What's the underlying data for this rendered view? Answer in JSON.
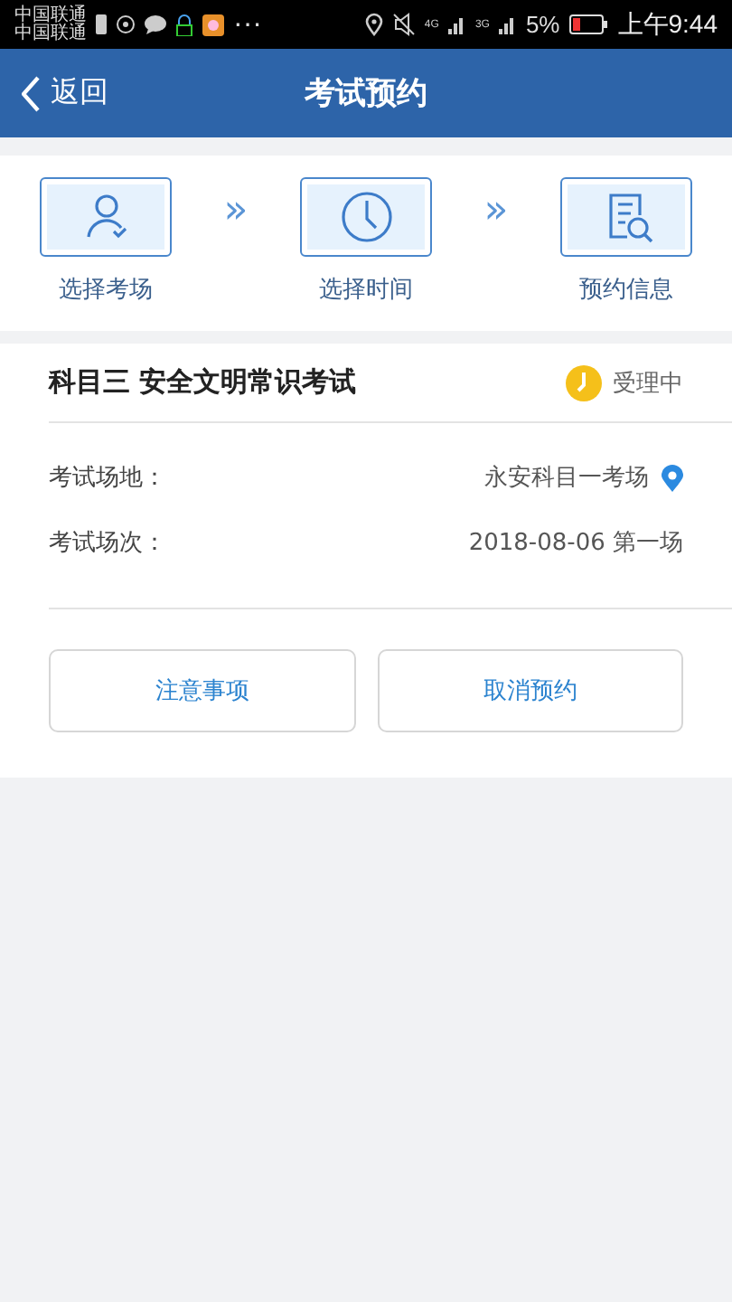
{
  "status_bar": {
    "carriers": [
      "中国联通",
      "中国联通"
    ],
    "more": "···",
    "network_1": "4G",
    "network_2": "3G",
    "battery": "5%",
    "time": "上午9:44"
  },
  "header": {
    "back": "返回",
    "title": "考试预约"
  },
  "steps": [
    {
      "kind": "person",
      "label": "选择考场"
    },
    {
      "kind": "clock",
      "label": "选择时间"
    },
    {
      "kind": "document",
      "label": "预约信息"
    }
  ],
  "step_separators": [
    "»",
    "»"
  ],
  "appointment": {
    "title": "科目三 安全文明常识考试",
    "status": {
      "label": "受理中",
      "color": "#f5c01a"
    },
    "fields": [
      {
        "label": "考试场地：",
        "value": "永安科目一考场",
        "kind": "location"
      },
      {
        "label": "考试场次：",
        "value": "2018-08-06 第一场",
        "kind": "plain"
      }
    ],
    "buttons": [
      "注意事项",
      "取消预约"
    ]
  }
}
